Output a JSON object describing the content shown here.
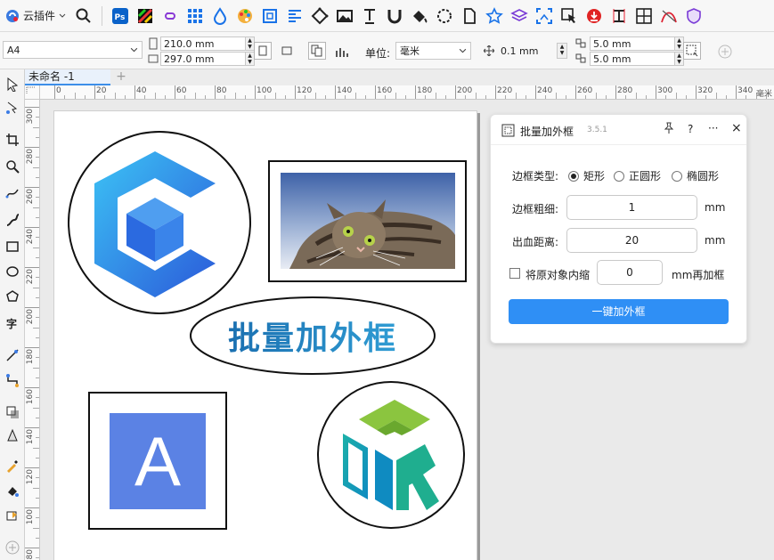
{
  "topbar": {
    "plugin_label": "云插件",
    "tools": [
      "ps-icon",
      "color-icon",
      "link-icon",
      "grid-icon",
      "drop-icon",
      "palette-icon",
      "frame-icon",
      "align-icon",
      "node-icon",
      "image-icon",
      "text-icon",
      "magnet-icon",
      "fill-icon",
      "rotate-icon",
      "page-icon",
      "star-icon",
      "layers-icon",
      "crop-icon",
      "cursor-icon",
      "download-icon",
      "text-width-icon",
      "mesh-icon",
      "curve-icon",
      "shield-icon"
    ]
  },
  "propbar": {
    "page_size": "A4",
    "width": "210.0 mm",
    "height": "297.0 mm",
    "unit_label": "单位:",
    "unit_value": "毫米",
    "nudge": "0.1 mm",
    "dup_x": "5.0 mm",
    "dup_y": "5.0 mm"
  },
  "tab": {
    "name": "未命名 -1",
    "add": "+"
  },
  "ruler": {
    "h_ticks": [
      "0",
      "20",
      "40",
      "60",
      "80",
      "100",
      "120",
      "140",
      "160",
      "180",
      "200",
      "220",
      "240",
      "260",
      "280",
      "300",
      "320",
      "340"
    ],
    "v_ticks": [
      "300",
      "280",
      "260",
      "240",
      "220",
      "200",
      "180",
      "160",
      "140",
      "120",
      "100",
      "80"
    ],
    "unit": "毫米"
  },
  "canvas": {
    "banner_text": "批量加外框",
    "letter_a": "A"
  },
  "panel": {
    "title": "批量加外框",
    "version": "3.5.1",
    "pin": "⚑",
    "help": "?",
    "more": "···",
    "close": "×",
    "frame_type_label": "边框类型:",
    "frame_options": [
      "矩形",
      "正圆形",
      "椭圆形"
    ],
    "selected_option": "矩形",
    "thickness_label": "边框粗细:",
    "thickness_value": "1",
    "thickness_unit": "mm",
    "bleed_label": "出血距离:",
    "bleed_value": "20",
    "bleed_unit": "mm",
    "shrink_label": "将原对象内缩",
    "shrink_value": "0",
    "shrink_suffix": "mm再加框",
    "shrink_checked": false,
    "apply_button": "一键加外框"
  },
  "colors": {
    "accent": "#2f8ff5",
    "cube_blue": "#2f6de0",
    "banner_dark": "#1565a8",
    "banner_light": "#35a7dc",
    "a_bg": "#5b82e4",
    "cdr_green": "#8bc53f",
    "cdr_teal": "#13a5a5"
  }
}
